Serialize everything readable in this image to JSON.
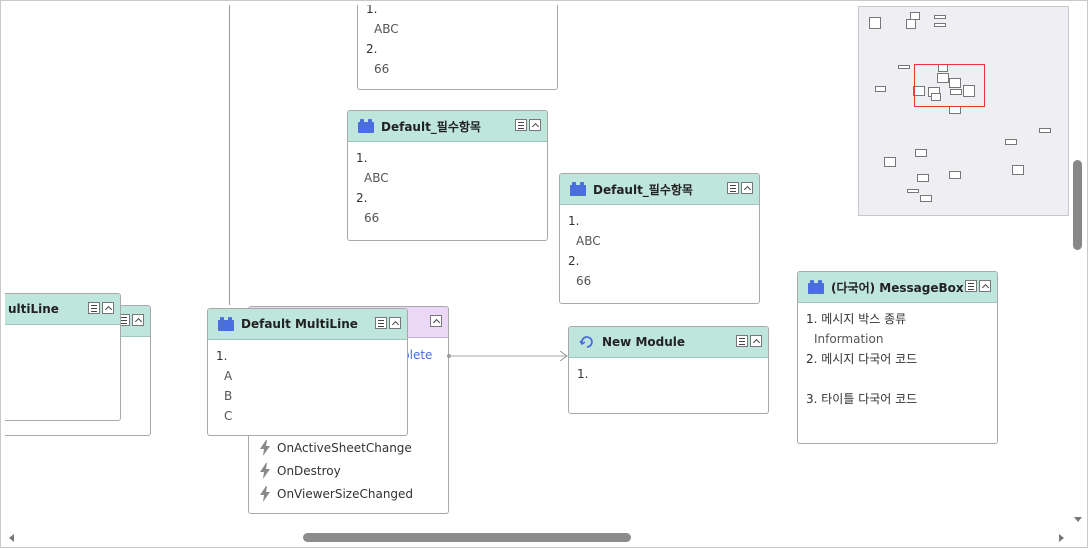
{
  "nodes": {
    "top": {
      "line1": "1.",
      "val1": "ABC",
      "line2": "2.",
      "val2": "66"
    },
    "required1": {
      "title": "Default_필수항목",
      "line1": "1.",
      "val1": "ABC",
      "line2": "2.",
      "val2": "66"
    },
    "required2": {
      "title": "Default_필수항목",
      "line1": "1.",
      "val1": "ABC",
      "line2": "2.",
      "val2": "66"
    },
    "multiline_left": {
      "title": "ultiLine"
    },
    "multiline_main": {
      "title": "Default MultiLine",
      "line1": "1.",
      "items": [
        "A",
        "B",
        "C"
      ]
    },
    "purple": {
      "partial_label": "plete",
      "events": [
        "OnActiveSheetChange",
        "OnDestroy",
        "OnViewerSizeChanged"
      ]
    },
    "new_module": {
      "title": "New Module",
      "line1": "1."
    },
    "messagebox": {
      "title": "(다국어) MessageBox",
      "line1": "1. 메시지 박스 종류",
      "val1": "Information",
      "line2": "2. 메시지 다국어 코드",
      "line3": "3. 타이틀 다국어 코드"
    }
  },
  "icons": {
    "node_icon": "puzzle-icon",
    "module_icon": "refresh-icon",
    "event_icon": "lightning-icon",
    "list_button": "list-icon",
    "collapse_button": "chevron-up-icon"
  },
  "colors": {
    "node_header": "#bfe6dc",
    "purple_header": "#ead8f6",
    "node_icon": "#4a6de0",
    "minimap_viewport": "#e33333"
  }
}
